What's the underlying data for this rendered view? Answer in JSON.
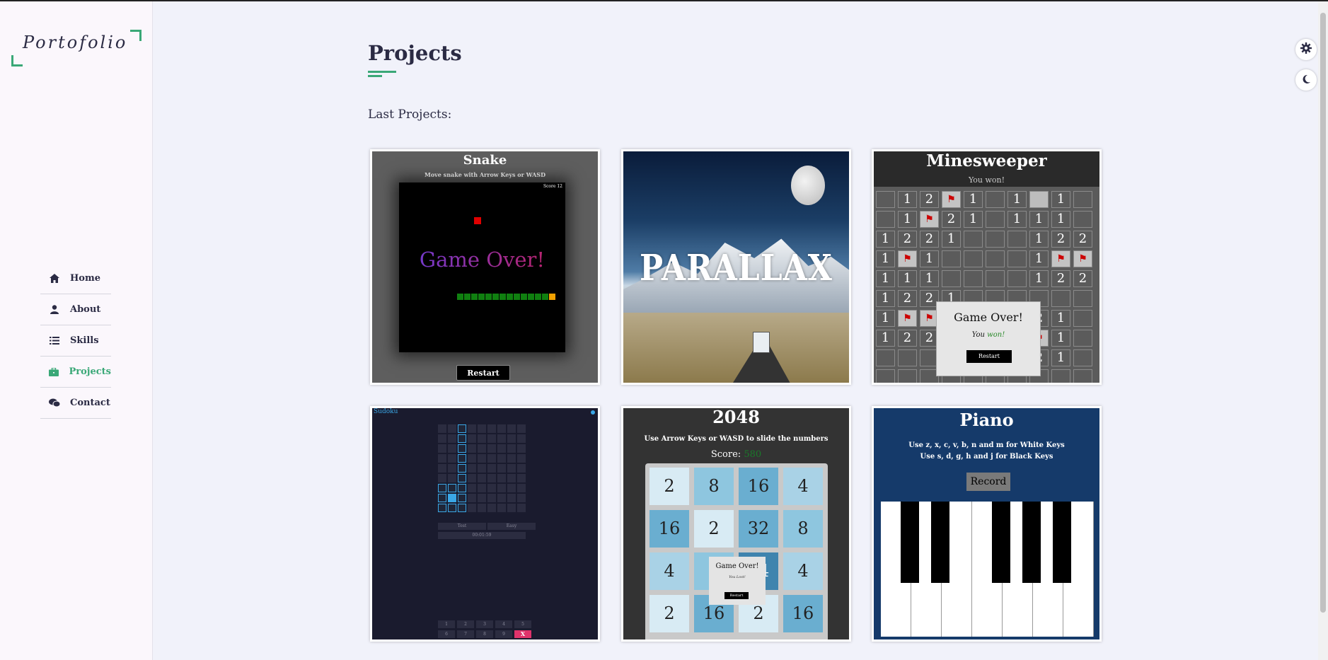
{
  "logo": {
    "text": "Portofolio"
  },
  "nav": {
    "items": [
      {
        "label": "Home",
        "icon": "home-icon"
      },
      {
        "label": "About",
        "icon": "user-icon"
      },
      {
        "label": "Skills",
        "icon": "list-icon"
      },
      {
        "label": "Projects",
        "icon": "briefcase-icon",
        "active": true
      },
      {
        "label": "Contact",
        "icon": "chat-icon"
      }
    ]
  },
  "page": {
    "title": "Projects",
    "subtitle": "Last Projects:"
  },
  "colors": {
    "accent": "#3aa877",
    "text": "#2b2b44",
    "background": "#f1f2fa"
  },
  "toolbar": {
    "settings_icon": "gear-icon",
    "theme_icon": "moon-icon"
  },
  "projects": {
    "snake": {
      "title": "Snake",
      "instructions": "Move snake with Arrow Keys or WASD",
      "score": "Score 12",
      "game_over": "Game Over!",
      "restart": "Restart"
    },
    "parallax": {
      "title": "PARALLAX"
    },
    "minesweeper": {
      "title": "Minesweeper",
      "status": "You won!",
      "rows": [
        [
          "",
          "1",
          "2",
          "F",
          "1",
          "",
          "1",
          "O",
          "1",
          ""
        ],
        [
          "",
          "1",
          "F",
          "2",
          "1",
          "",
          "1",
          "1",
          "1",
          ""
        ],
        [
          "1",
          "2",
          "2",
          "1",
          "",
          "",
          "",
          "1",
          "2",
          "2"
        ],
        [
          "1",
          "F",
          "1",
          "",
          "",
          "",
          "",
          "1",
          "F",
          "F"
        ],
        [
          "1",
          "1",
          "1",
          "",
          "",
          "",
          "",
          "1",
          "2",
          "2"
        ],
        [
          "1",
          "2",
          "2",
          "1",
          "",
          "",
          "",
          "",
          "",
          ""
        ],
        [
          "1",
          "F",
          "F",
          "",
          "",
          "",
          "",
          "2",
          "1",
          ""
        ],
        [
          "1",
          "2",
          "2",
          "",
          "",
          "",
          "",
          "F",
          "1",
          ""
        ],
        [
          "",
          "",
          "",
          "",
          "",
          "",
          "",
          "2",
          "1",
          ""
        ],
        [
          "",
          "",
          "",
          "",
          "",
          "",
          "",
          "",
          "",
          ""
        ]
      ],
      "popup_title": "Game Over!",
      "popup_text_prefix": "You",
      "popup_text_result": "won!",
      "popup_button": "Restart"
    },
    "sudoku": {
      "title": "Sudoku",
      "buttons": [
        "Test",
        "Easy"
      ],
      "timer": "00:01:59",
      "keypad": [
        "1",
        "2",
        "3",
        "4",
        "5",
        "6",
        "7",
        "8",
        "9",
        "X"
      ]
    },
    "game2048": {
      "title": "2048",
      "instructions": "Use Arrow Keys or WASD to slide the numbers",
      "score_label": "Score:",
      "score_value": "580",
      "tiles": [
        2,
        8,
        16,
        4,
        16,
        2,
        32,
        8,
        4,
        8,
        64,
        4,
        2,
        16,
        2,
        16
      ],
      "popup_title": "Game Over!",
      "popup_text": "You Lost!",
      "popup_button": "Restart"
    },
    "piano": {
      "title": "Piano",
      "line1": "Use z, x, c, v, b, n and m for White Keys",
      "line2": "Use s, d, g, h and j for Black Keys",
      "record": "Record"
    }
  }
}
